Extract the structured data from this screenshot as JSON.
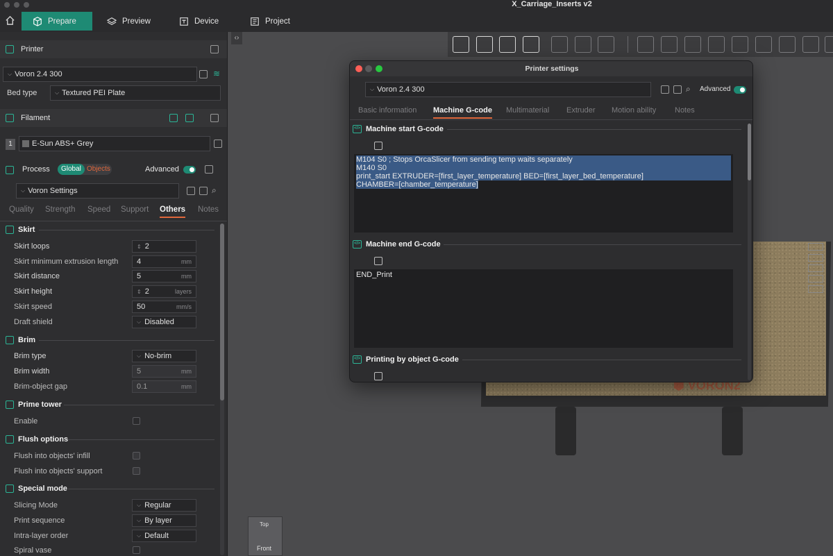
{
  "window": {
    "title": "X_Carriage_Inserts v2"
  },
  "nav": {
    "tabs": [
      "Prepare",
      "Preview",
      "Device",
      "Project"
    ]
  },
  "printer": {
    "section_label": "Printer",
    "name": "Voron 2.4 300",
    "bed_type_label": "Bed type",
    "bed_type_value": "Textured PEI Plate"
  },
  "filament": {
    "section_label": "Filament",
    "slot_number": "1",
    "name": "E-Sun ABS+ Grey"
  },
  "process": {
    "section_label": "Process",
    "global_label": "Global",
    "objects_label": "Objects",
    "advanced_label": "Advanced",
    "preset": "Voron Settings",
    "tabs": [
      "Quality",
      "Strength",
      "Speed",
      "Support",
      "Others",
      "Notes"
    ]
  },
  "groups": {
    "skirt": "Skirt",
    "brim": "Brim",
    "prime_tower": "Prime tower",
    "flush": "Flush options",
    "special": "Special mode"
  },
  "rows": {
    "skirt_loops": {
      "label": "Skirt loops",
      "value": "2"
    },
    "skirt_min_ext": {
      "label": "Skirt minimum extrusion length",
      "value": "4",
      "unit": "mm"
    },
    "skirt_distance": {
      "label": "Skirt distance",
      "value": "5",
      "unit": "mm"
    },
    "skirt_height": {
      "label": "Skirt height",
      "value": "2",
      "unit": "layers"
    },
    "skirt_speed": {
      "label": "Skirt speed",
      "value": "50",
      "unit": "mm/s"
    },
    "draft_shield": {
      "label": "Draft shield",
      "value": "Disabled"
    },
    "brim_type": {
      "label": "Brim type",
      "value": "No-brim"
    },
    "brim_width": {
      "label": "Brim width",
      "value": "5",
      "unit": "mm"
    },
    "brim_gap": {
      "label": "Brim-object gap",
      "value": "0.1",
      "unit": "mm"
    },
    "enable": {
      "label": "Enable"
    },
    "flush_infill": {
      "label": "Flush into objects' infill"
    },
    "flush_support": {
      "label": "Flush into objects' support"
    },
    "slicing_mode": {
      "label": "Slicing Mode",
      "value": "Regular"
    },
    "print_sequence": {
      "label": "Print sequence",
      "value": "By layer"
    },
    "intra_layer": {
      "label": "Intra-layer order",
      "value": "Default"
    },
    "spiral_vase": {
      "label": "Spiral vase"
    }
  },
  "viewcube": {
    "top": "Top",
    "front": "Front"
  },
  "dialog": {
    "title": "Printer settings",
    "preset": "Voron 2.4 300",
    "advanced_label": "Advanced",
    "tabs": [
      "Basic information",
      "Machine G-code",
      "Multimaterial",
      "Extruder",
      "Motion ability",
      "Notes"
    ],
    "start_label": "Machine start G-code",
    "start_code": [
      "M104 S0 ; Stops OrcaSlicer from sending temp waits separately",
      "M140 S0",
      "print_start EXTRUDER=[first_layer_temperature] BED=[first_layer_bed_temperature]",
      "CHAMBER=[chamber_temperature]"
    ],
    "end_label": "Machine end G-code",
    "end_code": [
      "END_Print"
    ],
    "object_label": "Printing by object G-code"
  },
  "colors": {
    "accent": "#1e8a74",
    "tab_underline": "#e0673b",
    "icon_green": "#2bb596",
    "selection": "#3a5a86"
  }
}
